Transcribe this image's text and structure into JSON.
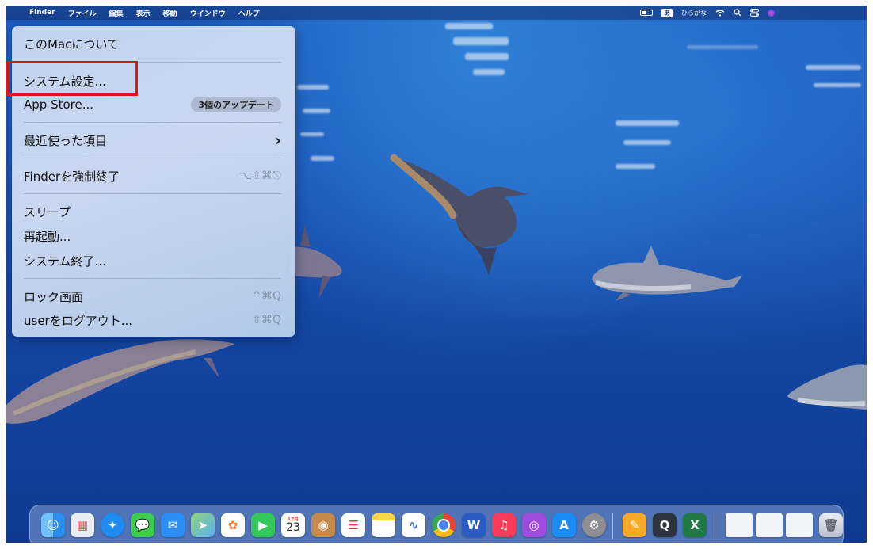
{
  "menubar": {
    "apple": "",
    "items": [
      "Finder",
      "ファイル",
      "編集",
      "表示",
      "移動",
      "ウインドウ",
      "ヘルプ"
    ],
    "input_method_badge": "あ",
    "input_method_label": "ひらがな"
  },
  "apple_menu": {
    "about": "このMacについて",
    "system_settings": "システム設定...",
    "app_store": "App Store...",
    "app_store_badge": "3個のアップデート",
    "recent_items": "最近使った項目",
    "recent_items_arrow": "›",
    "force_quit": "Finderを強制終了",
    "force_quit_shortcut": "⌥⇧⌘⎋",
    "sleep": "スリープ",
    "restart": "再起動...",
    "shutdown": "システム終了...",
    "lock_screen": "ロック画面",
    "lock_screen_shortcut": "^⌘Q",
    "logout": "userをログアウト...",
    "logout_shortcut": "⇧⌘Q"
  },
  "dock": {
    "calendar_month": "12月",
    "calendar_day": "23",
    "word_label": "W",
    "excel_label": "X"
  },
  "colors": {
    "highlight": "#e0141a",
    "desktop": "#1a55b8"
  }
}
